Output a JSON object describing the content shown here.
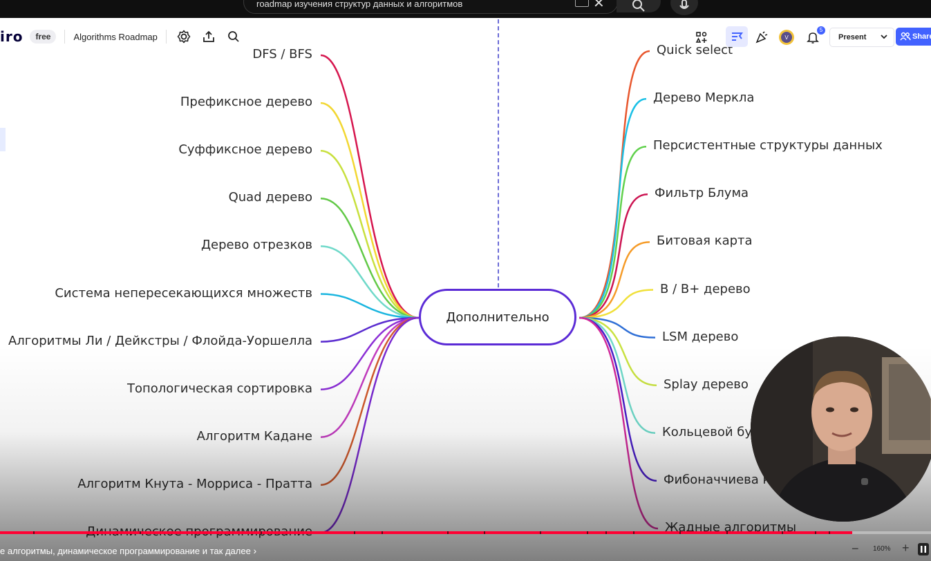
{
  "youtube": {
    "search_query": "roadmap изучения структур данных и алгоритмов"
  },
  "miro": {
    "logo": "iro",
    "plan_badge": "free",
    "board_name": "Algorithms Roadmap",
    "notifications_count": "5",
    "present_label": "Present",
    "share_label": "Share",
    "zoom_level": "160%",
    "zoom_minus": "−",
    "zoom_plus": "+"
  },
  "mindmap": {
    "center": "Дополнительно",
    "left": [
      {
        "label": "DFS / BFS",
        "color": "#d6174f"
      },
      {
        "label": "Префиксное дерево",
        "color": "#f2d732"
      },
      {
        "label": "Суффиксное дерево",
        "color": "#c8e03e"
      },
      {
        "label": "Quad дерево",
        "color": "#62c947"
      },
      {
        "label": "Дерево отрезков",
        "color": "#6fd9c9"
      },
      {
        "label": "Система непересекающихся множеств",
        "color": "#19b5df"
      },
      {
        "label": "Алгоритмы Ли / Дейкстры / Флойда-Уоршелла",
        "color": "#5a2ccf"
      },
      {
        "label": "Топологическая сортировка",
        "color": "#8c2fd6"
      },
      {
        "label": "Алгоритм Кадане",
        "color": "#c23bbf"
      },
      {
        "label": "Алгоритм Кнута - Морриса - Пратта",
        "color": "#d15a2d"
      },
      {
        "label": "Динамическое программирование",
        "color": "#7a2ad1"
      }
    ],
    "right": [
      {
        "label": "Quick select",
        "color": "#e8572e"
      },
      {
        "label": "Дерево Меркла",
        "color": "#1bc0e6"
      },
      {
        "label": "Персистентные структуры данных",
        "color": "#61d14d"
      },
      {
        "label": "Фильтр Блума",
        "color": "#cc1452"
      },
      {
        "label": "Битовая карта",
        "color": "#f59b28"
      },
      {
        "label": "B / B+ дерево",
        "color": "#f0e03a"
      },
      {
        "label": "LSM дерево",
        "color": "#2f6fd6"
      },
      {
        "label": "Splay дерево",
        "color": "#c9e241"
      },
      {
        "label": "Кольцевой бу",
        "color": "#6fd9c9"
      },
      {
        "label": "Фибоначчиева к",
        "color": "#4b1fc9"
      },
      {
        "label": "Жадные алгоритмы",
        "color": "#d12a9a"
      }
    ]
  },
  "player": {
    "chapter_title": "е алгоритмы, динамическое программирование и так далее",
    "progress_fraction": 0.915,
    "chapter_markers": [
      0.036,
      0.15,
      0.28,
      0.38,
      0.41,
      0.48,
      0.52,
      0.58,
      0.63,
      0.65,
      0.68,
      0.73,
      0.78,
      0.84,
      0.875,
      0.89
    ]
  },
  "colors": {
    "center_border": "#5b2bd6",
    "progress": "#ff0033",
    "share_button": "#4262ff"
  },
  "icons": [
    "settings-icon",
    "upload-icon",
    "search-icon",
    "shapes-icon",
    "cursor-icon",
    "party-icon",
    "avatar",
    "bell-icon",
    "chevron-down-icon",
    "people-icon",
    "close-icon",
    "mic-icon",
    "pause-icon"
  ]
}
